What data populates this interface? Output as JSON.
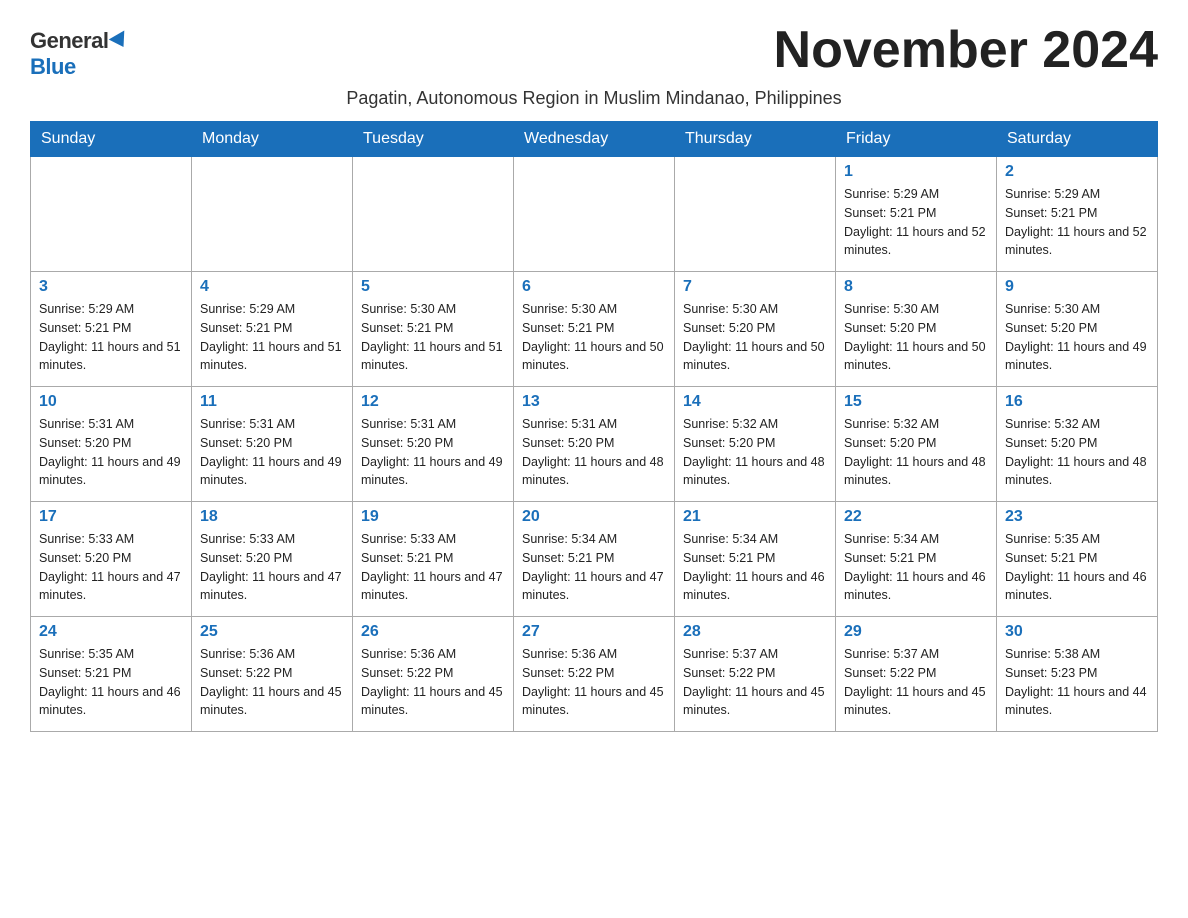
{
  "logo": {
    "general": "General",
    "blue": "Blue"
  },
  "title": "November 2024",
  "subtitle": "Pagatin, Autonomous Region in Muslim Mindanao, Philippines",
  "weekdays": [
    "Sunday",
    "Monday",
    "Tuesday",
    "Wednesday",
    "Thursday",
    "Friday",
    "Saturday"
  ],
  "weeks": [
    [
      {
        "day": "",
        "sunrise": "",
        "sunset": "",
        "daylight": ""
      },
      {
        "day": "",
        "sunrise": "",
        "sunset": "",
        "daylight": ""
      },
      {
        "day": "",
        "sunrise": "",
        "sunset": "",
        "daylight": ""
      },
      {
        "day": "",
        "sunrise": "",
        "sunset": "",
        "daylight": ""
      },
      {
        "day": "",
        "sunrise": "",
        "sunset": "",
        "daylight": ""
      },
      {
        "day": "1",
        "sunrise": "Sunrise: 5:29 AM",
        "sunset": "Sunset: 5:21 PM",
        "daylight": "Daylight: 11 hours and 52 minutes."
      },
      {
        "day": "2",
        "sunrise": "Sunrise: 5:29 AM",
        "sunset": "Sunset: 5:21 PM",
        "daylight": "Daylight: 11 hours and 52 minutes."
      }
    ],
    [
      {
        "day": "3",
        "sunrise": "Sunrise: 5:29 AM",
        "sunset": "Sunset: 5:21 PM",
        "daylight": "Daylight: 11 hours and 51 minutes."
      },
      {
        "day": "4",
        "sunrise": "Sunrise: 5:29 AM",
        "sunset": "Sunset: 5:21 PM",
        "daylight": "Daylight: 11 hours and 51 minutes."
      },
      {
        "day": "5",
        "sunrise": "Sunrise: 5:30 AM",
        "sunset": "Sunset: 5:21 PM",
        "daylight": "Daylight: 11 hours and 51 minutes."
      },
      {
        "day": "6",
        "sunrise": "Sunrise: 5:30 AM",
        "sunset": "Sunset: 5:21 PM",
        "daylight": "Daylight: 11 hours and 50 minutes."
      },
      {
        "day": "7",
        "sunrise": "Sunrise: 5:30 AM",
        "sunset": "Sunset: 5:20 PM",
        "daylight": "Daylight: 11 hours and 50 minutes."
      },
      {
        "day": "8",
        "sunrise": "Sunrise: 5:30 AM",
        "sunset": "Sunset: 5:20 PM",
        "daylight": "Daylight: 11 hours and 50 minutes."
      },
      {
        "day": "9",
        "sunrise": "Sunrise: 5:30 AM",
        "sunset": "Sunset: 5:20 PM",
        "daylight": "Daylight: 11 hours and 49 minutes."
      }
    ],
    [
      {
        "day": "10",
        "sunrise": "Sunrise: 5:31 AM",
        "sunset": "Sunset: 5:20 PM",
        "daylight": "Daylight: 11 hours and 49 minutes."
      },
      {
        "day": "11",
        "sunrise": "Sunrise: 5:31 AM",
        "sunset": "Sunset: 5:20 PM",
        "daylight": "Daylight: 11 hours and 49 minutes."
      },
      {
        "day": "12",
        "sunrise": "Sunrise: 5:31 AM",
        "sunset": "Sunset: 5:20 PM",
        "daylight": "Daylight: 11 hours and 49 minutes."
      },
      {
        "day": "13",
        "sunrise": "Sunrise: 5:31 AM",
        "sunset": "Sunset: 5:20 PM",
        "daylight": "Daylight: 11 hours and 48 minutes."
      },
      {
        "day": "14",
        "sunrise": "Sunrise: 5:32 AM",
        "sunset": "Sunset: 5:20 PM",
        "daylight": "Daylight: 11 hours and 48 minutes."
      },
      {
        "day": "15",
        "sunrise": "Sunrise: 5:32 AM",
        "sunset": "Sunset: 5:20 PM",
        "daylight": "Daylight: 11 hours and 48 minutes."
      },
      {
        "day": "16",
        "sunrise": "Sunrise: 5:32 AM",
        "sunset": "Sunset: 5:20 PM",
        "daylight": "Daylight: 11 hours and 48 minutes."
      }
    ],
    [
      {
        "day": "17",
        "sunrise": "Sunrise: 5:33 AM",
        "sunset": "Sunset: 5:20 PM",
        "daylight": "Daylight: 11 hours and 47 minutes."
      },
      {
        "day": "18",
        "sunrise": "Sunrise: 5:33 AM",
        "sunset": "Sunset: 5:20 PM",
        "daylight": "Daylight: 11 hours and 47 minutes."
      },
      {
        "day": "19",
        "sunrise": "Sunrise: 5:33 AM",
        "sunset": "Sunset: 5:21 PM",
        "daylight": "Daylight: 11 hours and 47 minutes."
      },
      {
        "day": "20",
        "sunrise": "Sunrise: 5:34 AM",
        "sunset": "Sunset: 5:21 PM",
        "daylight": "Daylight: 11 hours and 47 minutes."
      },
      {
        "day": "21",
        "sunrise": "Sunrise: 5:34 AM",
        "sunset": "Sunset: 5:21 PM",
        "daylight": "Daylight: 11 hours and 46 minutes."
      },
      {
        "day": "22",
        "sunrise": "Sunrise: 5:34 AM",
        "sunset": "Sunset: 5:21 PM",
        "daylight": "Daylight: 11 hours and 46 minutes."
      },
      {
        "day": "23",
        "sunrise": "Sunrise: 5:35 AM",
        "sunset": "Sunset: 5:21 PM",
        "daylight": "Daylight: 11 hours and 46 minutes."
      }
    ],
    [
      {
        "day": "24",
        "sunrise": "Sunrise: 5:35 AM",
        "sunset": "Sunset: 5:21 PM",
        "daylight": "Daylight: 11 hours and 46 minutes."
      },
      {
        "day": "25",
        "sunrise": "Sunrise: 5:36 AM",
        "sunset": "Sunset: 5:22 PM",
        "daylight": "Daylight: 11 hours and 45 minutes."
      },
      {
        "day": "26",
        "sunrise": "Sunrise: 5:36 AM",
        "sunset": "Sunset: 5:22 PM",
        "daylight": "Daylight: 11 hours and 45 minutes."
      },
      {
        "day": "27",
        "sunrise": "Sunrise: 5:36 AM",
        "sunset": "Sunset: 5:22 PM",
        "daylight": "Daylight: 11 hours and 45 minutes."
      },
      {
        "day": "28",
        "sunrise": "Sunrise: 5:37 AM",
        "sunset": "Sunset: 5:22 PM",
        "daylight": "Daylight: 11 hours and 45 minutes."
      },
      {
        "day": "29",
        "sunrise": "Sunrise: 5:37 AM",
        "sunset": "Sunset: 5:22 PM",
        "daylight": "Daylight: 11 hours and 45 minutes."
      },
      {
        "day": "30",
        "sunrise": "Sunrise: 5:38 AM",
        "sunset": "Sunset: 5:23 PM",
        "daylight": "Daylight: 11 hours and 44 minutes."
      }
    ]
  ]
}
